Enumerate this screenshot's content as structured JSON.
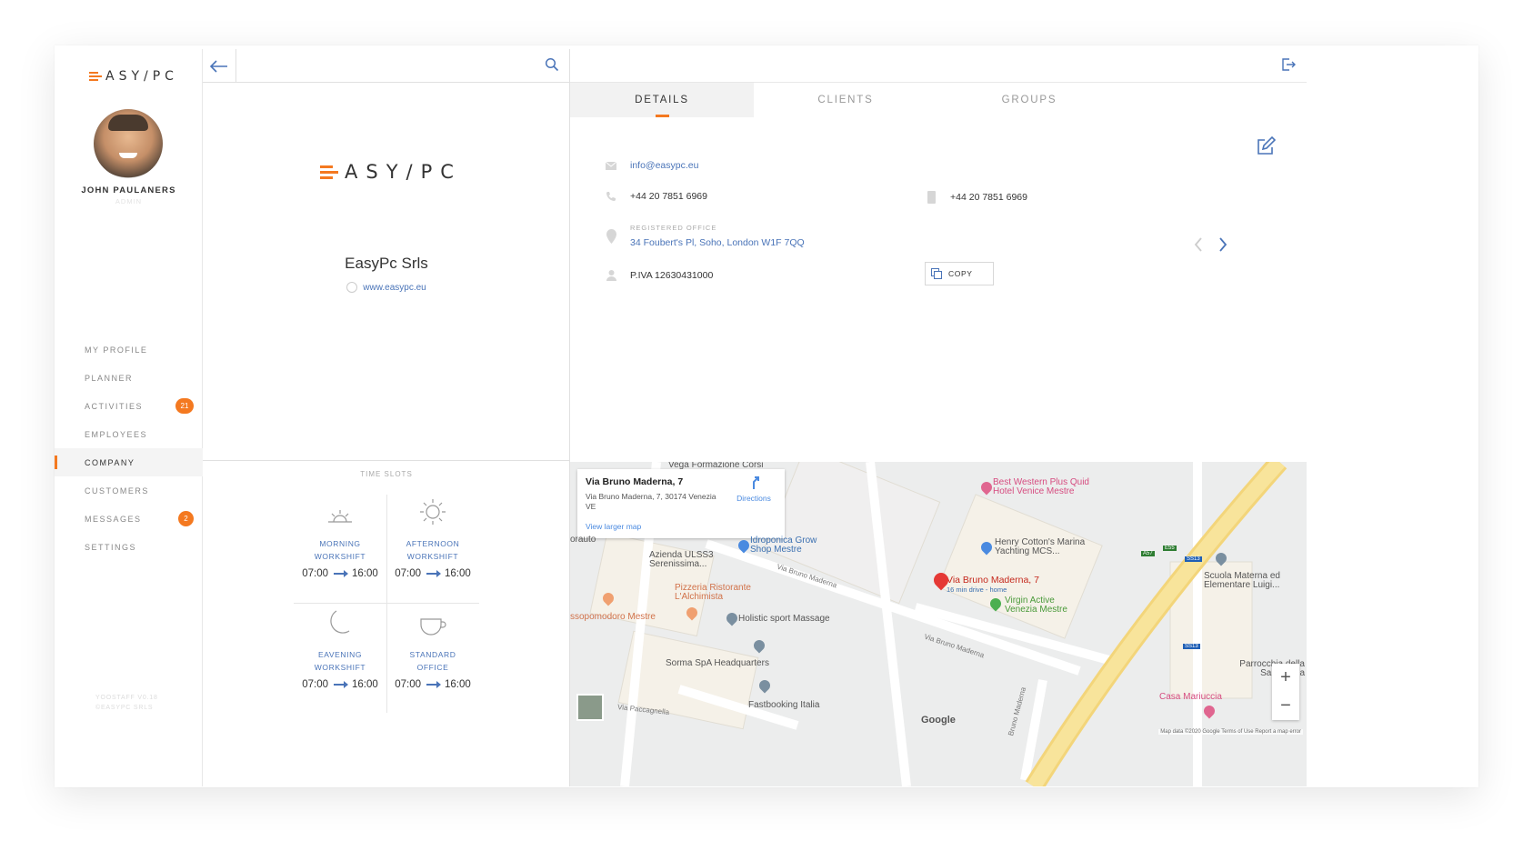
{
  "brand": {
    "logo_text": "ASY/PC",
    "logo_prefix": "E",
    "accent": "#f47920",
    "link_color": "#4a74b8"
  },
  "user": {
    "name": "JOHN PAULANERS",
    "role": "ADMIN"
  },
  "nav": {
    "items": [
      {
        "label": "MY PROFILE",
        "active": false
      },
      {
        "label": "PLANNER",
        "active": false
      },
      {
        "label": "ACTIVITIES",
        "badge": "21",
        "active": false
      },
      {
        "label": "EMPLOYEES",
        "active": false
      },
      {
        "label": "COMPANY",
        "active": true
      },
      {
        "label": "CUSTOMERS",
        "active": false
      },
      {
        "label": "MESSAGES",
        "badge": "2",
        "active": false
      },
      {
        "label": "SETTINGS",
        "active": false
      }
    ]
  },
  "version": {
    "line1": "YOOSTAFF V0.18",
    "line2": "©EASYPC SRLS"
  },
  "company": {
    "logo_text": "ASY/PC",
    "logo_prefix": "E",
    "name": "EasyPc Srls",
    "website": "www.easypc.eu"
  },
  "timeslots": {
    "title": "TIME SLOTS",
    "slots": [
      {
        "label_1": "MORNING",
        "label_2": "WORKSHIFT",
        "start": "07:00",
        "end": "16:00",
        "icon": "sunrise-icon"
      },
      {
        "label_1": "AFTERNOON",
        "label_2": "WORKSHIFT",
        "start": "07:00",
        "end": "16:00",
        "icon": "sun-icon"
      },
      {
        "label_1": "EAVENING",
        "label_2": "WORKSHIFT",
        "start": "07:00",
        "end": "16:00",
        "icon": "moon-icon"
      },
      {
        "label_1": "STANDARD",
        "label_2": "OFFICE",
        "start": "07:00",
        "end": "16:00",
        "icon": "coffee-cup-icon"
      }
    ]
  },
  "tabs": [
    {
      "label": "DETAILS",
      "active": true
    },
    {
      "label": "CLIENTS",
      "active": false
    },
    {
      "label": "GROUPS",
      "active": false
    }
  ],
  "details": {
    "email": "info@easypc.eu",
    "phone": "+44 20 7851 6969",
    "mobile": "+44 20 7851 6969",
    "office_label": "REGISTERED OFFICE",
    "office_address": "34 Foubert's Pl, Soho, London W1F 7QQ",
    "vat": "P.IVA 12630431000",
    "copy_label": "COPY"
  },
  "map": {
    "info_title": "Via Bruno Maderna, 7",
    "info_address": "Via Bruno Maderna, 7, 30174 Venezia VE",
    "info_directions": "Directions",
    "info_larger": "View larger map",
    "places": [
      "Vega Formazione Corsi",
      "Best Western Plus Quid Hotel Venice Mestre",
      "Idroponica Grow Shop Mestre",
      "Azienda ULSS3 Serenissima...",
      "Henry Cotton's Marina Yachting MCS...",
      "Pizzeria Ristorante L'Alchimista",
      "Via Bruno Maderna, 7",
      "16 min drive - home",
      "Virgin Active Venezia Mestre",
      "Scuola Materna ed Elementare Luigi...",
      "ssopomodoro Mestre",
      "Holistic sport Massage",
      "Sorma SpA Headquarters",
      "Fastbooking Italia",
      "Parrocchia della Santissima",
      "Casa Mariuccia",
      "orauto"
    ],
    "roads": [
      "Via Bruno Maderna",
      "Via Bruno Maderna",
      "Via Paccagnella",
      "Bruno Maderna"
    ],
    "shields": [
      "A57",
      "E55",
      "SS13",
      "SS13"
    ],
    "google": "Google",
    "footer": "Map data ©2020 Google   Terms of Use   Report a map error",
    "zoom_in": "+",
    "zoom_out": "−"
  }
}
